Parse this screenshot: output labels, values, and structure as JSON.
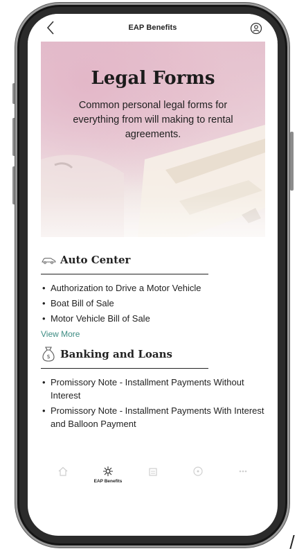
{
  "header": {
    "title": "EAP Benefits"
  },
  "hero": {
    "title": "Legal Forms",
    "subtitle": "Common personal legal forms for everything from will making to rental agreements."
  },
  "sections": [
    {
      "title": "Auto Center",
      "icon": "car-icon",
      "items": [
        "Authorization to Drive a Motor Vehicle",
        "Boat Bill of Sale",
        "Motor Vehicle Bill of Sale"
      ],
      "view_more": "View More"
    },
    {
      "title": "Banking and Loans",
      "icon": "money-bag-icon",
      "items": [
        "Promissory Note - Installment Payments Without Interest",
        "Promissory Note - Installment Payments With Interest and Balloon Payment"
      ]
    }
  ],
  "tabbar": {
    "tabs": [
      {
        "label": "",
        "icon": "home-icon"
      },
      {
        "label": "EAP Benefits",
        "icon": "eap-emblem-icon",
        "active": true
      },
      {
        "label": "",
        "icon": "building-icon"
      },
      {
        "label": "",
        "icon": "compass-icon"
      },
      {
        "label": "",
        "icon": "more-icon"
      }
    ]
  },
  "colors": {
    "accent_link": "#3d8c83",
    "hero_pink": "#e3b7c8",
    "text": "#222222"
  }
}
